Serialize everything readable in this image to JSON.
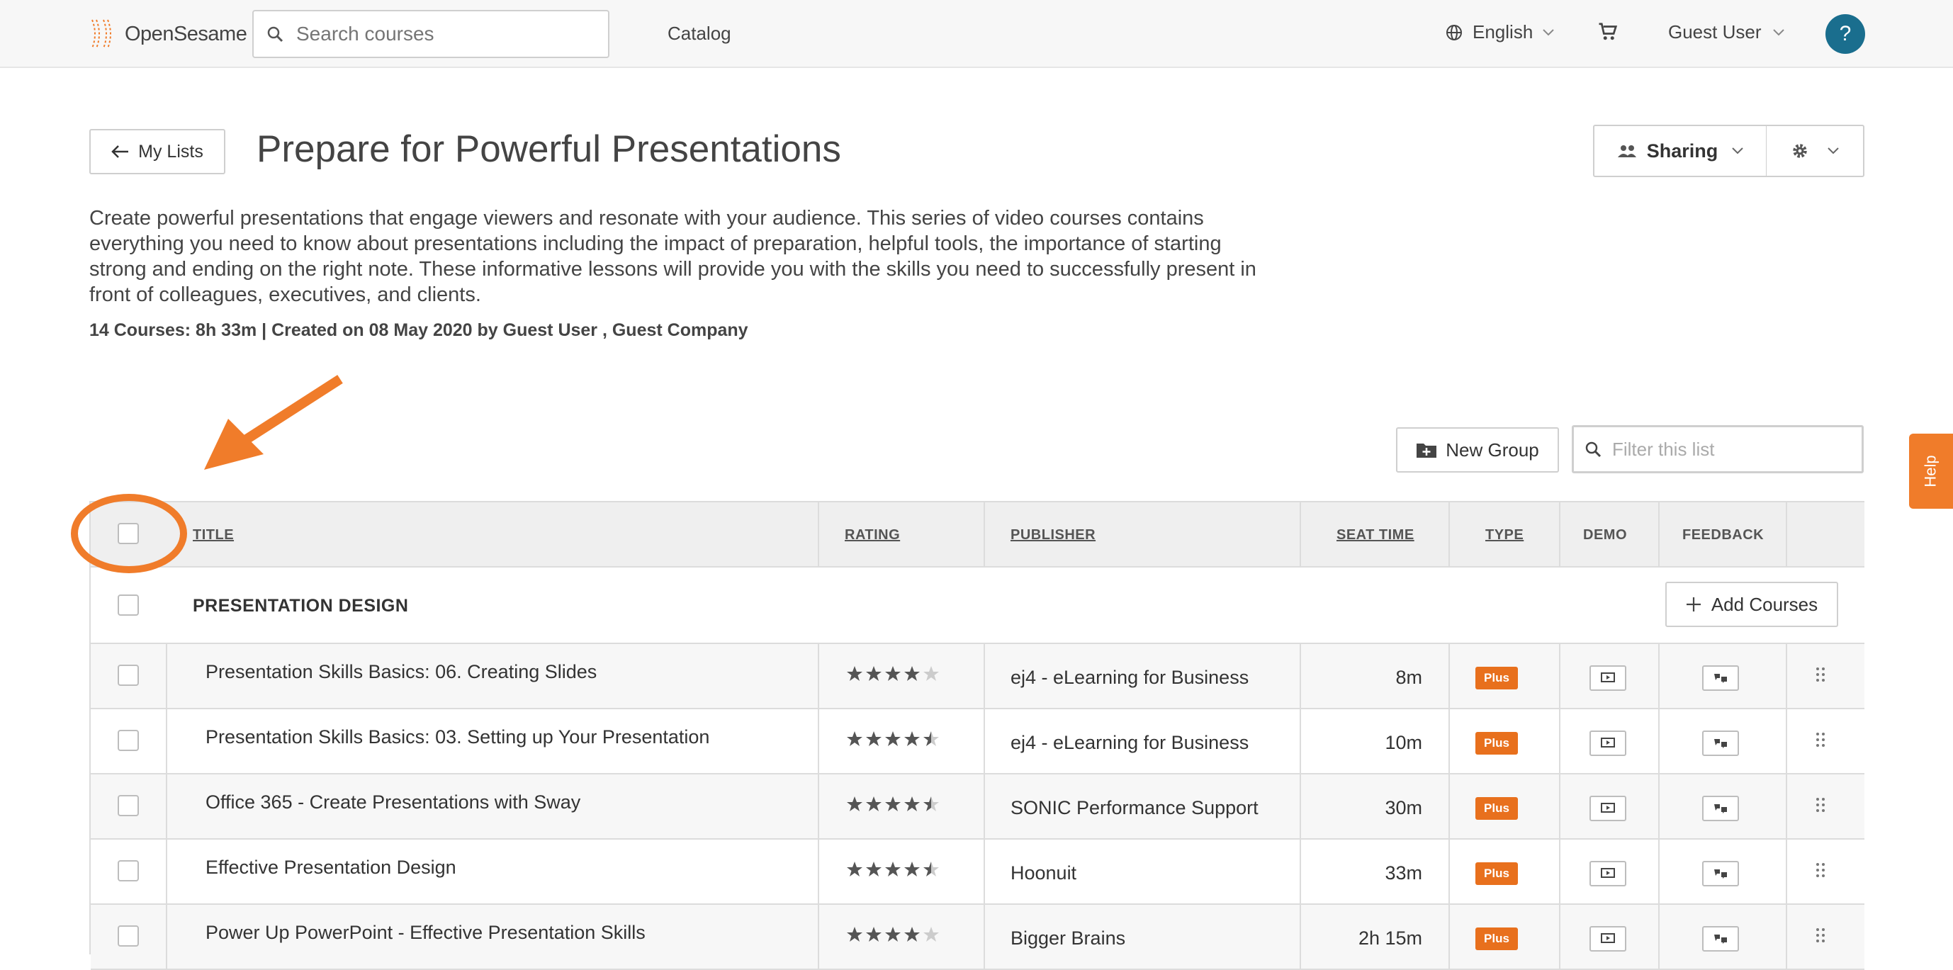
{
  "header": {
    "logo_text": "OpenSesame",
    "search_placeholder": "Search courses",
    "nav_catalog": "Catalog",
    "language": "English",
    "user": "Guest User",
    "help_label": "?"
  },
  "page": {
    "back_label": "My Lists",
    "title": "Prepare for Powerful Presentations",
    "sharing_label": "Sharing",
    "description": "Create powerful presentations that engage viewers and resonate with your audience. This series of video courses contains everything you need to know about presentations including the impact of preparation, helpful tools, the importance of starting strong and ending on the right note. These informative lessons will provide you with the skills you need to successfully present in front of colleagues, executives, and clients.",
    "meta": "14 Courses: 8h 33m | Created on 08 May 2020 by Guest User , Guest Company"
  },
  "toolbar": {
    "new_group_label": "New Group",
    "filter_placeholder": "Filter this list"
  },
  "help_tab": "Help",
  "table": {
    "headers": {
      "title": "TITLE",
      "rating": "RATING",
      "publisher": "PUBLISHER",
      "seat_time": "SEAT TIME",
      "type": "TYPE",
      "demo": "DEMO",
      "feedback": "FEEDBACK"
    },
    "group": {
      "name": "PRESENTATION DESIGN",
      "add_courses_label": "Add Courses"
    },
    "rows": [
      {
        "title": "Presentation Skills Basics: 06. Creating Slides",
        "rating": 4,
        "publisher": "ej4 - eLearning for Business",
        "seat_time": "8m",
        "type": "Plus"
      },
      {
        "title": "Presentation Skills Basics: 03. Setting up Your Presentation",
        "rating": 4.5,
        "publisher": "ej4 - eLearning for Business",
        "seat_time": "10m",
        "type": "Plus"
      },
      {
        "title": "Office 365 - Create Presentations with Sway",
        "rating": 4.5,
        "publisher": "SONIC Performance Support",
        "seat_time": "30m",
        "type": "Plus"
      },
      {
        "title": "Effective Presentation Design",
        "rating": 4.5,
        "publisher": "Hoonuit",
        "seat_time": "33m",
        "type": "Plus"
      },
      {
        "title": "Power Up PowerPoint - Effective Presentation Skills",
        "rating": 4,
        "publisher": "Bigger Brains",
        "seat_time": "2h 15m",
        "type": "Plus"
      }
    ]
  },
  "colors": {
    "accent": "#e8701d",
    "annotation": "#f07c2a",
    "help_button": "#1a6e8e"
  }
}
